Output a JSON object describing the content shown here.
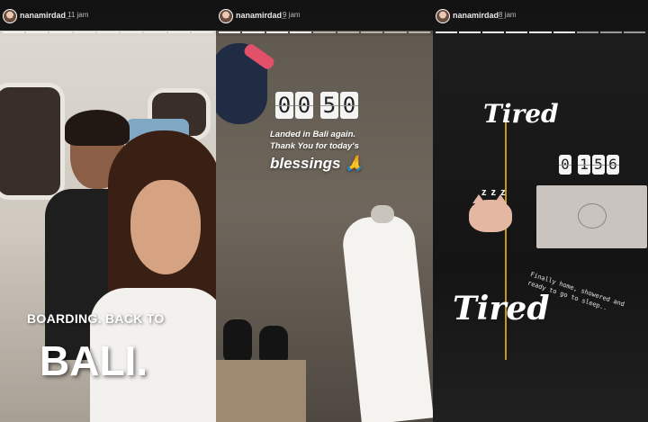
{
  "stories": [
    {
      "username": "nanamirdad_",
      "time": "11 jam",
      "caption_line1": "BOARDING. BACK TO",
      "caption_line2": "BALI."
    },
    {
      "username": "nanamirdad_",
      "time": "9 jam",
      "clock": [
        "0",
        "0",
        "5",
        "0"
      ],
      "caption_line1": "Landed in Bali again.",
      "caption_line2": "Thank You for today's",
      "caption_line3": "blessings 🙏"
    },
    {
      "username": "nanamirdad_",
      "time": "8 jam",
      "clock": [
        "0",
        "1",
        "5",
        "6"
      ],
      "title_top": "Tired",
      "title_bottom": "Tired",
      "zzz": "z z z",
      "note": "Finally home, showered and ready to go to sleep.."
    }
  ],
  "colors": {
    "accent_line": "#c99521",
    "topbar": "#111111"
  },
  "icons": [
    "avatar-icon",
    "sleeping-cat-icon"
  ]
}
